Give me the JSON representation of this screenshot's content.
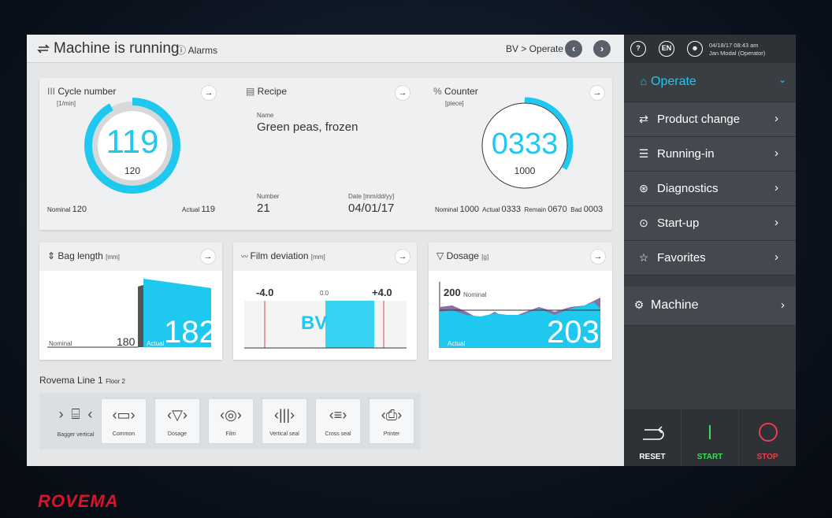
{
  "topbar": {
    "title": "Machine is running",
    "alarms": "ⓘ Alarms",
    "breadcrumb": "BV > Operate",
    "prev": "‹",
    "next": "›"
  },
  "cycle": {
    "title": "Cycle number",
    "unit": "[1/min]",
    "value": "119",
    "nominal_value": "120",
    "nominal_label": "Nominal",
    "nominal": "120",
    "actual_label": "Actual",
    "actual": "119",
    "arc_fraction": 0.92
  },
  "recipe": {
    "title": "Recipe",
    "name_label": "Name",
    "name": "Green peas, frozen",
    "number_label": "Number",
    "number": "21",
    "date_label": "Date [mm/dd/yy]",
    "date": "04/01/17"
  },
  "counter": {
    "title": "Counter",
    "unit": "[piece]",
    "value": "0333",
    "nominal_value": "1000",
    "nominal_label": "Nominal",
    "nominal": "1000",
    "actual_label": "Actual",
    "actual": "0333",
    "remain_label": "Remain",
    "remain": "0670",
    "bad_label": "Bad",
    "bad": "0003",
    "arc_fraction": 0.333
  },
  "bag": {
    "title": "Bag length",
    "unit": "[mm]",
    "nominal_label": "Nominal",
    "nominal": "180",
    "actual_label": "Actual",
    "actual": "182"
  },
  "film": {
    "title": "Film deviation",
    "unit": "[mm]",
    "min": "-4.0",
    "zero": "0.0",
    "max": "+4.0",
    "label": "BV"
  },
  "dosage": {
    "title": "Dosage",
    "unit": "[g]",
    "nominal_value": "200",
    "nominal_label": "Nominal",
    "actual_label": "Actual",
    "actual": "203"
  },
  "line": {
    "title": "Rovema Line 1",
    "floor": "Floor 2"
  },
  "tiles": [
    {
      "label": "Bagger vertical",
      "icon": "bagger-icon"
    },
    {
      "label": "Common",
      "icon": "common-icon"
    },
    {
      "label": "Dosage",
      "icon": "funnel-icon"
    },
    {
      "label": "Film",
      "icon": "film-icon"
    },
    {
      "label": "Vertical seal",
      "icon": "vertical-seal-icon"
    },
    {
      "label": "Cross seal",
      "icon": "cross-seal-icon"
    },
    {
      "label": "Printer",
      "icon": "printer-icon"
    }
  ],
  "right": {
    "help": "?",
    "lang": "EN",
    "datetime": "04/18/17 08:43 am",
    "user": "Jan Modal (Operator)"
  },
  "menu": {
    "operate": "Operate",
    "product_change": "Product change",
    "running_in": "Running-in",
    "diagnostics": "Diagnostics",
    "startup": "Start-up",
    "favorites": "Favorites",
    "machine": "Machine"
  },
  "actions": {
    "reset": "RESET",
    "start": "START",
    "stop": "STOP"
  },
  "colors": {
    "accent": "#1ec8ee",
    "start": "#3ddc5a",
    "stop": "#e8404c",
    "panel": "#3a3d42"
  },
  "logo": "ROVEMA"
}
